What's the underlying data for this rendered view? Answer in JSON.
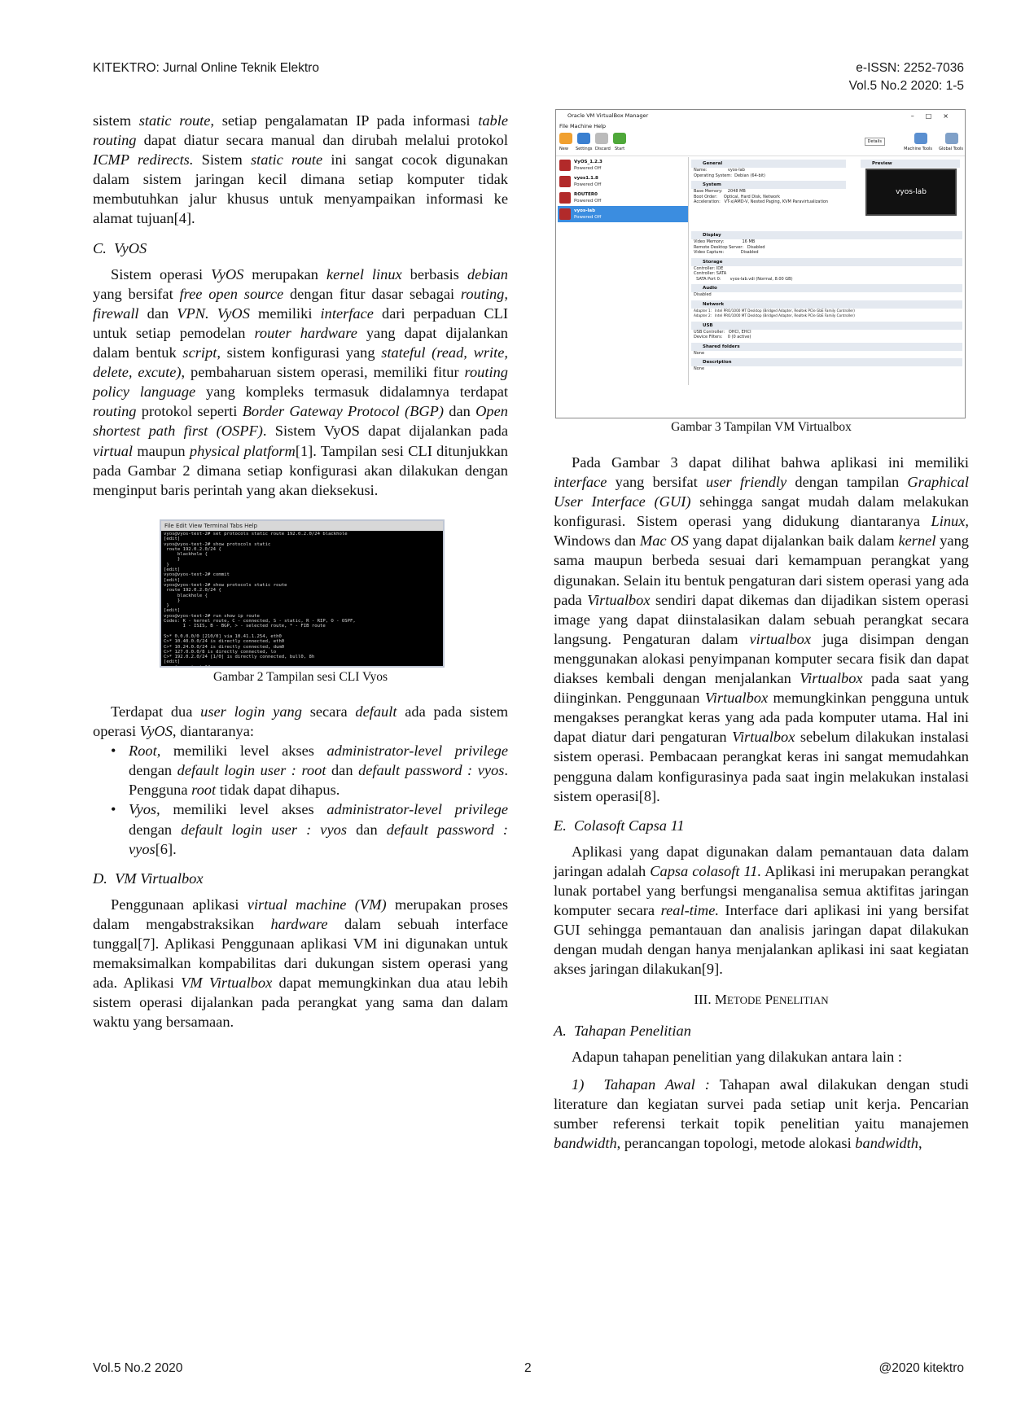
{
  "header": {
    "journal": "KITEKTRO: Jurnal Online Teknik Elektro",
    "issn": "e-ISSN: 2252-7036",
    "volume": "Vol.5 No.2 2020: 1-5"
  },
  "left": {
    "p_static": [
      "sistem ",
      "static route,",
      " setiap pengalamatan IP pada informasi ",
      "table routing",
      " dapat diatur secara manual dan dirubah melalui protokol ",
      "ICMP redirects.",
      " Sistem ",
      "static route",
      " ini sangat cocok digunakan dalam sistem jaringan kecil dimana setiap komputer tidak membutuhkan jalur khusus untuk menyampaikan informasi ke alamat tujuan[4]."
    ],
    "sec_c": "C.  VyOS",
    "p_vyos": [
      "Sistem operasi ",
      "VyOS",
      " merupakan ",
      "kernel linux",
      " berbasis ",
      "debian",
      " yang bersifat ",
      "free open source",
      " dengan fitur dasar sebagai ",
      "routing, firewall",
      " dan ",
      "VPN. VyOS",
      " memiliki ",
      "interface",
      " dari perpaduan CLI untuk setiap pemodelan ",
      "router hardware",
      " yang dapat dijalankan dalam bentuk ",
      "script",
      ", sistem konfigurasi yang ",
      "stateful (read, write, delete, excute)",
      ", pembaharuan sistem operasi, memiliki fitur ",
      "routing policy language",
      " yang kompleks termasuk didalamnya terdapat ",
      "routing",
      " protokol seperti ",
      "Border Gateway Protocol (BGP)",
      " dan ",
      "Open shortest path first (OSPF)",
      ". Sistem VyOS dapat dijalankan pada ",
      "virtual",
      " maupun ",
      "physical platform",
      "[1]. Tampilan sesi CLI ditunjukkan pada Gambar 2 dimana setiap konfigurasi akan dilakukan dengan menginput baris perintah yang akan dieksekusi."
    ],
    "fig2_caption": "Gambar 2  Tampilan sesi CLI Vyos",
    "p_login": [
      "Terdapat dua ",
      "user login yang",
      " secara ",
      "default",
      " ada pada sistem operasi ",
      "VyOS",
      ", diantaranya:"
    ],
    "bullet_root": [
      "Root,",
      " memiliki level akses ",
      "administrator-level privilege",
      " dengan ",
      "default login user : root",
      " dan ",
      "default password : vyos",
      ". Pengguna ",
      "root",
      " tidak dapat dihapus."
    ],
    "bullet_vyos": [
      "Vyos,",
      " memiliki level akses ",
      "administrator-level privilege",
      " dengan ",
      "default login user : vyos",
      " dan ",
      "default password : vyos",
      "[6]."
    ],
    "sec_d": "D.  VM Virtualbox",
    "p_vm": [
      "Penggunaan aplikasi ",
      "virtual machine (VM)",
      " merupakan proses dalam mengabstraksikan ",
      "hardware",
      " dalam sebuah interface tunggal[7]. Aplikasi Penggunaan aplikasi VM ini digunakan untuk memaksimalkan kompabilitas dari dukungan sistem operasi yang ada. Aplikasi ",
      "VM Virtualbox",
      " dapat memungkinkan dua atau lebih sistem operasi dijalankan pada perangkat yang sama dan dalam waktu yang bersamaan."
    ]
  },
  "terminal": {
    "menu": "File  Edit  View  Terminal  Tabs  Help",
    "lines": "vyos@vyos-test-2# set protocols static route 192.0.2.0/24 blackhole\n[edit]\nvyos@vyos-test-2# show protocols static\n route 192.0.2.0/24 {\n     blackhole {\n     }\n }\n[edit]\nvyos@vyos-test-2# commit\n[edit]\nvyos@vyos-test-2# show protocols static route\n route 192.0.2.0/24 {\n     blackhole {\n     }\n }\n[edit]\nvyos@vyos-test-2# run show ip route\nCodes: K - kernel route, C - connected, S - static, R - RIP, O - OSPF,\n       I - ISIS, B - BGP, > - selected route, * - FIB route\n\nS>* 0.0.0.0/0 [210/0] via 10.41.1.254, eth0\nC>* 10.40.0.0/24 is directly connected, eth0\nC>* 10.24.0.0/24 is directly connected, dum0\nC>* 127.0.0.0/8 is directly connected, lo\nC>* 192.0.2.0/24 [1/0] is directly connected, bull0, 8h\n[edit]\nvyos@vyos-test-2# "
  },
  "vbox": {
    "title": "Oracle VM VirtualBox Manager",
    "menu": "File   Machine   Help",
    "tools": [
      "New",
      "Settings",
      "Discard",
      "Start"
    ],
    "right_tools": [
      "Details",
      "Machine Tools",
      "Global Tools"
    ],
    "vms": [
      {
        "name": "VyOS_1.2.3",
        "state": "Powered Off"
      },
      {
        "name": "vyos1.1.8",
        "state": "Powered Off"
      },
      {
        "name": "ROUTER0",
        "state": "Powered Off"
      },
      {
        "name": "vyos-lab",
        "state": "Powered Off"
      }
    ],
    "general_h": "General",
    "general": "Name:                vyos-lab\nOperating System:  Debian (64-bit)",
    "system_h": "System",
    "system": "Base Memory:    2048 MB\nBoot Order:     Optical, Hard Disk, Network\nAcceleration:   VT-x/AMD-V, Nested Paging, KVM Paravirtualization",
    "preview_h": "Preview",
    "preview_name": "vyos-lab",
    "display_h": "Display",
    "display": "Video Memory:              16 MB\nRemote Desktop Server:   Disabled\nVideo Capture:             Disabled",
    "storage_h": "Storage",
    "storage": "Controller: IDE\nController: SATA\n  SATA Port 0:       vyos-lab.vdi (Normal, 8.00 GB)",
    "audio_h": "Audio",
    "audio": "Disabled",
    "network_h": "Network",
    "network": "Adapter 1:   Intel PRO/1000 MT Desktop (Bridged Adapter, Realtek PCIe GbE Family Controller)\nAdapter 2:   Intel PRO/1000 MT Desktop (Bridged Adapter, Realtek PCIe GbE Family Controller)",
    "usb_h": "USB",
    "usb": "USB Controller:   OHCI, EHCI\nDevice Filters:    0 (0 active)",
    "shared_h": "Shared folders",
    "shared": "None",
    "desc_h": "Description",
    "desc": "None"
  },
  "right": {
    "fig3_caption": "Gambar 3  Tampilan VM Virtualbox",
    "p_gui": [
      "Pada Gambar 3 dapat dilihat bahwa aplikasi ini memiliki ",
      "interface",
      " yang bersifat ",
      "user friendly",
      " dengan tampilan ",
      "Graphical User Interface (GUI)",
      " sehingga sangat mudah dalam melakukan konfigurasi. Sistem operasi yang didukung diantaranya ",
      "Linux",
      ", Windows dan ",
      "Mac OS",
      " yang dapat dijalankan baik dalam ",
      "kernel",
      " yang sama maupun berbeda sesuai dari kemampuan perangkat yang digunakan. Selain itu bentuk pengaturan dari sistem operasi yang ada pada ",
      "Virtualbox",
      " sendiri dapat dikemas dan dijadikan sistem operasi image yang dapat diinstalasikan dalam sebuah perangkat secara langsung. Pengaturan dalam ",
      "virtualbox",
      " juga disimpan dengan menggunakan alokasi penyimpanan komputer secara fisik dan dapat diakses kembali dengan menjalankan ",
      "Virtualbox",
      " pada saat yang diinginkan. Penggunaan ",
      "Virtualbox",
      " memungkinkan pengguna untuk mengakses perangkat keras yang ada pada komputer utama. Hal ini dapat diatur dari pengaturan ",
      "Virtualbox",
      " sebelum dilakukan instalasi sistem operasi. Pembacaan perangkat keras ini sangat memudahkan pengguna dalam konfigurasinya pada saat ingin melakukan instalasi sistem operasi[8]."
    ],
    "sec_e": "E.  Colasoft Capsa 11",
    "p_capsa": [
      "Aplikasi yang dapat digunakan dalam pemantauan data dalam jaringan adalah ",
      "Capsa colasoft 11.",
      " Aplikasi ini merupakan perangkat lunak portabel yang berfungsi menganalisa semua aktifitas jaringan komputer secara ",
      "real-time.",
      " Interface dari aplikasi ini yang bersifat GUI sehingga pemantauan dan analisis jaringan dapat dilakukan dengan mudah dengan hanya menjalankan aplikasi ini saat kegiatan akses jaringan dilakukan[9]."
    ],
    "sec3_a": "III. M",
    "sec3_b": "ETODE",
    "sec3_c": " P",
    "sec3_d": "ENELITIAN",
    "sec_a": "A.  Tahapan Penelitian",
    "p_tahapan": "Adapun tahapan penelitian yang dilakukan antara lain :",
    "p_awal": [
      "1)  Tahapan Awal :",
      " Tahapan awal dilakukan dengan studi literature dan kegiatan survei pada setiap unit kerja. Pencarian sumber referensi terkait topik penelitian yaitu manajemen ",
      "bandwidth",
      ", perancangan topologi, metode alokasi ",
      "bandwidth",
      ","
    ]
  },
  "footer": {
    "left": "Vol.5 No.2 2020",
    "page": "2",
    "right": "@2020 kitektro"
  }
}
